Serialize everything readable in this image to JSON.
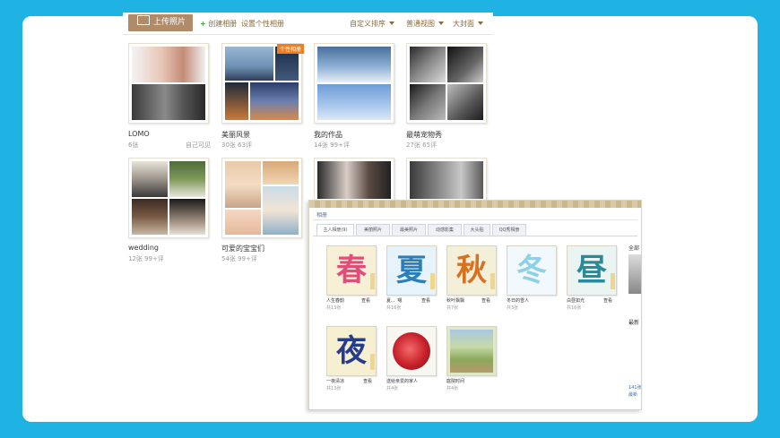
{
  "toolbar": {
    "upload_label": "上传照片",
    "create_album": "创建相册",
    "custom_album": "设置个性相册",
    "sort": "自定义排序",
    "view": "普通视图",
    "cover": "大封面"
  },
  "albums": [
    {
      "name": "LOMO",
      "count": "6张",
      "comments": "",
      "privacy": "自己可见",
      "ribbon": ""
    },
    {
      "name": "美丽风景",
      "count": "30张",
      "comments": "63评",
      "privacy": "",
      "ribbon": "个性相册"
    },
    {
      "name": "我的作品",
      "count": "14张",
      "comments": "99+评",
      "privacy": "",
      "ribbon": ""
    },
    {
      "name": "最萌宠物秀",
      "count": "27张",
      "comments": "65评",
      "privacy": "",
      "ribbon": ""
    },
    {
      "name": "wedding",
      "count": "12张",
      "comments": "99+评",
      "privacy": "",
      "ribbon": ""
    },
    {
      "name": "可爱的宝宝们",
      "count": "54张",
      "comments": "99+评",
      "privacy": "",
      "ribbon": ""
    }
  ],
  "second": {
    "title": "相册",
    "tabs": [
      "主人相册(9)",
      "美丽照片",
      "最美照片",
      "动感影集",
      "大头贴",
      "QQ秀相册"
    ],
    "items": [
      {
        "char": "春",
        "color": "#e04d7a",
        "bg": "#f7f0d6",
        "name": "人生春韵",
        "count": "共13张",
        "action": "查看"
      },
      {
        "char": "夏",
        "color": "#2b7fb8",
        "bg": "#e6f3fa",
        "name": "夏、、嗯",
        "count": "共16张",
        "action": "查看"
      },
      {
        "char": "秋",
        "color": "#d9701e",
        "bg": "#f4efd9",
        "name": "秋叶飘飘",
        "count": "共7张",
        "action": "查看"
      },
      {
        "char": "冬",
        "color": "#8fd0e8",
        "bg": "#f2f9fc",
        "name": "冬日的雪人",
        "count": "共3张",
        "action": ""
      },
      {
        "char": "昼",
        "color": "#2a8a9a",
        "bg": "#eaf4f2",
        "name": "白昼如光",
        "count": "共16张",
        "action": "查看"
      },
      {
        "char": "夜",
        "color": "#263c8a",
        "bg": "#f6efd2",
        "name": "一夜清凉",
        "count": "共13张",
        "action": "查看"
      },
      {
        "char": "",
        "color": "#c8202a",
        "bg": "#f7f7f2",
        "name": "送给亲爱的家人",
        "count": "共4张",
        "action": ""
      },
      {
        "char": "",
        "color": "#6a8a3a",
        "bg": "#dfe9c8",
        "name": "庭院时间",
        "count": "共4张",
        "action": ""
      }
    ],
    "side_title": "全部",
    "side_item": "最新",
    "side_link1": "141张",
    "side_link2": "最新"
  }
}
